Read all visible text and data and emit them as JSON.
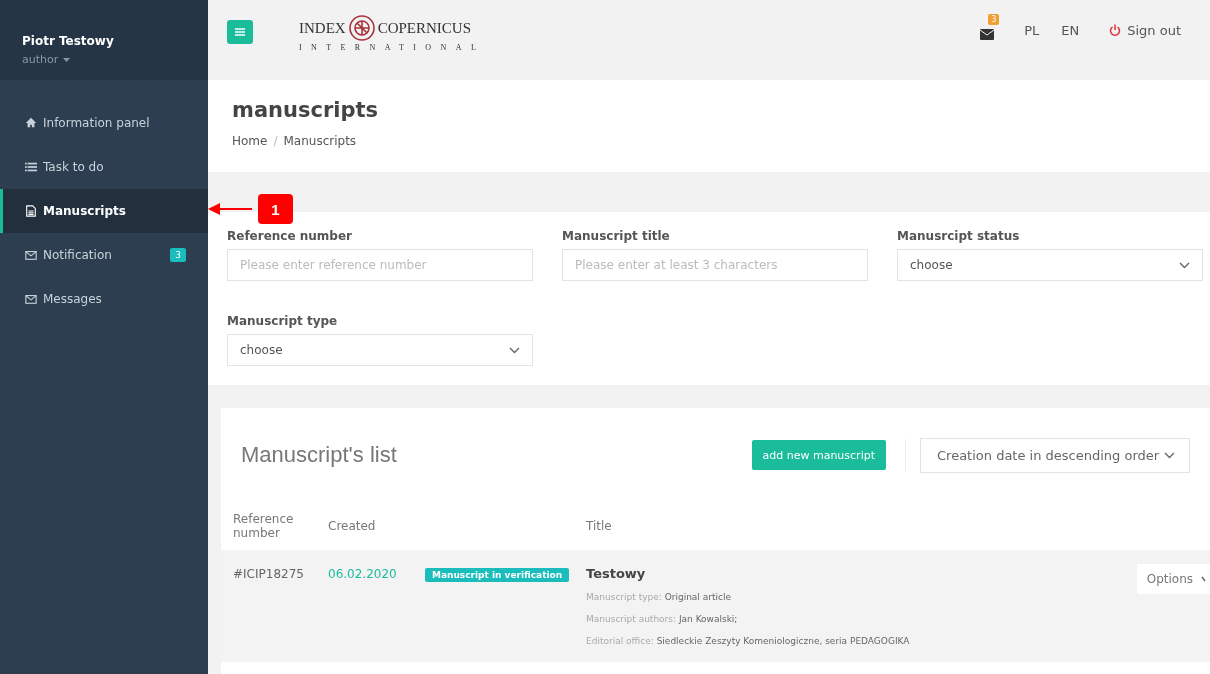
{
  "user": {
    "name": "Piotr Testowy",
    "role": "author"
  },
  "sidebar": {
    "items": [
      {
        "label": "Information panel",
        "selected": false
      },
      {
        "label": "Task to do",
        "selected": false
      },
      {
        "label": "Manuscripts",
        "selected": true
      },
      {
        "label": "Notification",
        "selected": false,
        "badge": "3"
      },
      {
        "label": "Messages",
        "selected": false
      }
    ]
  },
  "header": {
    "logo": {
      "left": "INDEX",
      "right": "COPERNICUS",
      "sub": "INTERNATIONAL"
    },
    "mail_badge": "3",
    "languages": [
      "PL",
      "EN"
    ],
    "sign_out": "Sign out"
  },
  "page": {
    "title": "manuscripts",
    "breadcrumb": [
      "Home",
      "Manuscripts"
    ],
    "breadcrumb_separator": "/"
  },
  "annotation": {
    "number": "1"
  },
  "filters": [
    {
      "kind": "input",
      "label": "Reference number",
      "placeholder": "Please enter reference number"
    },
    {
      "kind": "input",
      "label": "Manuscript title",
      "placeholder": "Please enter at least 3 characters"
    },
    {
      "kind": "select",
      "label": "Manusrcipt status",
      "value": "choose"
    },
    {
      "kind": "select",
      "label": "Manuscript type",
      "value": "choose"
    }
  ],
  "list": {
    "title": "Manuscript's list",
    "add_button": "add new manuscript",
    "sort": "Creation date in descending order",
    "columns": [
      "Reference number",
      "Created",
      "Title"
    ],
    "rows": [
      {
        "reference": "#ICIP18275",
        "created": "06.02.2020",
        "status": "Manuscript in verification",
        "title": "Testowy",
        "details": [
          {
            "label": "Manuscript type:",
            "value": "Original article"
          },
          {
            "label": "Manuscript authors:",
            "value": "Jan Kowalski;"
          },
          {
            "label": "Editorial office:",
            "value": "Siedleckie Zeszyty Komeniologiczne, seria PEDAGOGIKA"
          }
        ],
        "options": "Options"
      }
    ]
  }
}
